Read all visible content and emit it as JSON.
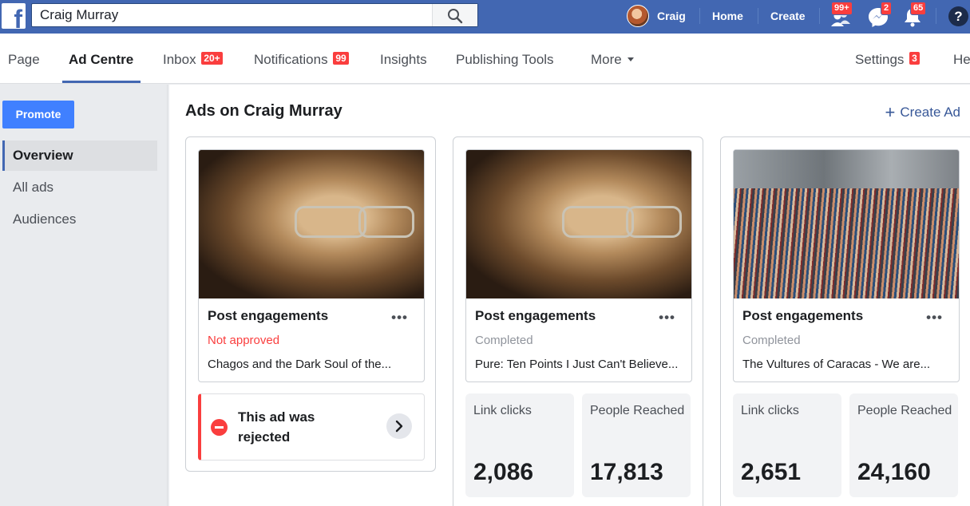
{
  "topbar": {
    "search_value": "Craig Murray",
    "user_name": "Craig",
    "home_label": "Home",
    "create_label": "Create",
    "friend_requests_badge": "99+",
    "messages_badge": "2",
    "notifications_badge": "65",
    "help_glyph": "?"
  },
  "tabs": {
    "page": "Page",
    "ad_centre": "Ad Centre",
    "inbox": "Inbox",
    "inbox_badge": "20+",
    "notifications": "Notifications",
    "notifications_badge": "99",
    "insights": "Insights",
    "publishing_tools": "Publishing Tools",
    "more": "More",
    "settings": "Settings",
    "settings_badge": "3",
    "help": "He"
  },
  "leftnav": {
    "promote_label": "Promote",
    "items": [
      {
        "label": "Overview"
      },
      {
        "label": "All ads"
      },
      {
        "label": "Audiences"
      }
    ]
  },
  "main": {
    "title": "Ads on Craig Murray",
    "create_ad_label": "Create Ad",
    "cards": [
      {
        "title": "Post engagements",
        "status": "Not approved",
        "description": "Chagos and the Dark Soul of the...",
        "rejection_message": "This ad was rejected"
      },
      {
        "title": "Post engagements",
        "status": "Completed",
        "description": "Pure: Ten Points I Just Can't Believe...",
        "metrics": [
          {
            "label": "Link clicks",
            "value": "2,086"
          },
          {
            "label": "People Reached",
            "value": "17,813"
          }
        ]
      },
      {
        "title": "Post engagements",
        "status": "Completed",
        "description": "The Vultures of Caracas - We are...",
        "metrics": [
          {
            "label": "Link clicks",
            "value": "2,651"
          },
          {
            "label": "People Reached",
            "value": "24,160"
          }
        ]
      }
    ]
  },
  "colors": {
    "brand_blue": "#4267b2",
    "promote_blue": "#4080ff",
    "alert_red": "#fa3e3e",
    "link_blue": "#385898"
  },
  "icons": {
    "logo": "facebook-logo",
    "search": "search-icon",
    "friends": "friends-icon",
    "messenger": "messenger-icon",
    "notifications": "bell-icon",
    "help": "help-icon",
    "rejected": "no-entry-icon",
    "chevron": "chevron-right-icon",
    "add": "plus-icon",
    "more": "more-dots-icon"
  }
}
